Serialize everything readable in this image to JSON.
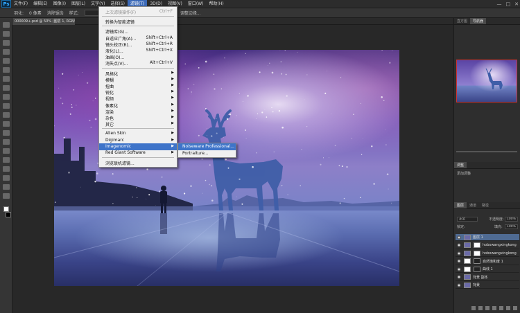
{
  "app": {
    "logo": "Ps"
  },
  "menubar": {
    "items": [
      "文件(F)",
      "编辑(E)",
      "图像(I)",
      "图层(L)",
      "文字(Y)",
      "选择(S)",
      "滤镜(T)",
      "3D(D)",
      "视图(V)",
      "窗口(W)",
      "帮助(H)"
    ],
    "active_index": 6,
    "window_controls": [
      "—",
      "□",
      "✕"
    ]
  },
  "optionsbar": {
    "labels": [
      "羽化:",
      "0 像素",
      "消除锯齿",
      "样式:",
      "调整边缘..."
    ]
  },
  "document_tab": {
    "title": "000009+.psd @ 50% (图层 1, RGB/8) * ×"
  },
  "filter_menu": {
    "rows": [
      {
        "label": "上次滤镜操作(F)",
        "shortcut": "Ctrl+F",
        "disabled": true
      },
      {
        "separator": true
      },
      {
        "label": "转换为智能滤镜"
      },
      {
        "separator": true
      },
      {
        "label": "滤镜库(G)..."
      },
      {
        "label": "自适应广角(A)...",
        "shortcut": "Shift+Ctrl+A"
      },
      {
        "label": "镜头校正(R)...",
        "shortcut": "Shift+Ctrl+R"
      },
      {
        "label": "液化(L)...",
        "shortcut": "Shift+Ctrl+X"
      },
      {
        "label": "油画(O)..."
      },
      {
        "label": "消失点(V)...",
        "shortcut": "Alt+Ctrl+V"
      },
      {
        "separator": true
      },
      {
        "label": "风格化",
        "submenu": true
      },
      {
        "label": "模糊",
        "submenu": true
      },
      {
        "label": "扭曲",
        "submenu": true
      },
      {
        "label": "锐化",
        "submenu": true
      },
      {
        "label": "视频",
        "submenu": true
      },
      {
        "label": "像素化",
        "submenu": true
      },
      {
        "label": "渲染",
        "submenu": true
      },
      {
        "label": "杂色",
        "submenu": true
      },
      {
        "label": "其它",
        "submenu": true
      },
      {
        "separator": true
      },
      {
        "label": "Alien Skin",
        "submenu": true
      },
      {
        "label": "Digimarc",
        "submenu": true
      },
      {
        "label": "Imagenomic",
        "submenu": true,
        "highlighted": true
      },
      {
        "label": "Red Giant Software",
        "submenu": true
      },
      {
        "separator": true
      },
      {
        "label": "浏览联机滤镜..."
      }
    ]
  },
  "submenu": {
    "items": [
      {
        "label": "Noiseware Professional...",
        "highlighted": true
      },
      {
        "label": "Portraiture..."
      }
    ]
  },
  "panels": {
    "top_tabs": [
      "直方图",
      "导航器"
    ],
    "mid_tabs": [
      "调整"
    ],
    "mid_label": "添加调整",
    "layers_tabs": [
      "图层",
      "通道",
      "路径"
    ],
    "blend_mode": "正常",
    "opacity_label": "不透明度:",
    "opacity_value": "100%",
    "lock_label": "锁定:",
    "fill_label": "填充:",
    "fill_value": "100%",
    "layers": [
      {
        "name": "图层 1",
        "selected": true,
        "thumb": "photo"
      },
      {
        "name": "hobowangxingkong",
        "selected": false,
        "thumb": "photo"
      },
      {
        "name": "hobowangxingkong",
        "selected": false,
        "thumb": "photo"
      },
      {
        "name": "自然饱和度 1",
        "selected": false,
        "thumb": "mask"
      },
      {
        "name": "曲线 1",
        "selected": false,
        "thumb": "mask"
      },
      {
        "name": "背景 副本",
        "selected": false,
        "thumb": "photo"
      },
      {
        "name": "背景",
        "selected": false,
        "thumb": "photo"
      }
    ]
  },
  "colors": {
    "menu_highlight": "#3e74c9",
    "layer_selected": "#4f6b93",
    "navigator_frame": "#cc3333"
  }
}
